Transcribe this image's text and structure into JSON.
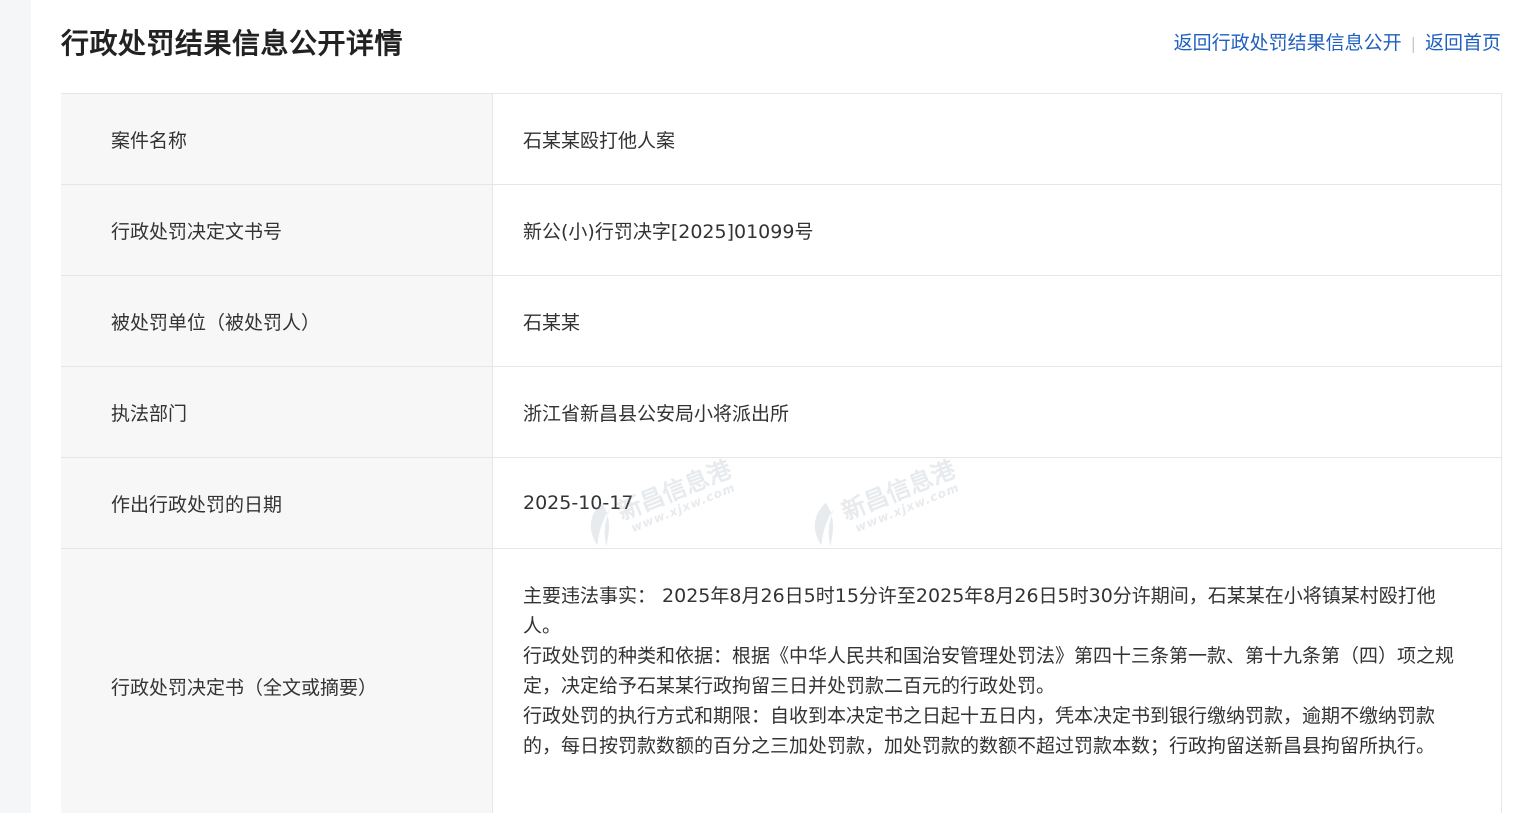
{
  "header": {
    "title": "行政处罚结果信息公开详情",
    "back_link": "返回行政处罚结果信息公开",
    "home_link": "返回首页",
    "separator": "|"
  },
  "case": {
    "rows": [
      {
        "label": "案件名称",
        "value": "石某某殴打他人案"
      },
      {
        "label": "行政处罚决定文书号",
        "value": "新公(小)行罚决字[2025]01099号"
      },
      {
        "label": "被处罚单位（被处罚人）",
        "value": "石某某"
      },
      {
        "label": "执法部门",
        "value": "浙江省新昌县公安局小将派出所"
      },
      {
        "label": "作出行政处罚的日期",
        "value": "2025-10-17"
      }
    ],
    "decision": {
      "label": "行政处罚决定书（全文或摘要）",
      "facts": "主要违法事实： 2025年8月26日5时15分许至2025年8月26日5时30分许期间，石某某在小将镇某村殴打他人。",
      "basis": "行政处罚的种类和依据：根据《中华人民共和国治安管理处罚法》第四十三条第一款、第十九条第（四）项之规定，决定给予石某某行政拘留三日并处罚款二百元的行政处罚。",
      "execution": "行政处罚的执行方式和期限：自收到本决定书之日起十五日内，凭本决定书到银行缴纳罚款，逾期不缴纳罚款的，每日按罚款数额的百分之三加处罚款，加处罚款的数额不超过罚款本数；行政拘留送新昌县拘留所执行。"
    }
  },
  "watermark": {
    "text": "新昌信息港",
    "url": "www.xjxw.com"
  }
}
